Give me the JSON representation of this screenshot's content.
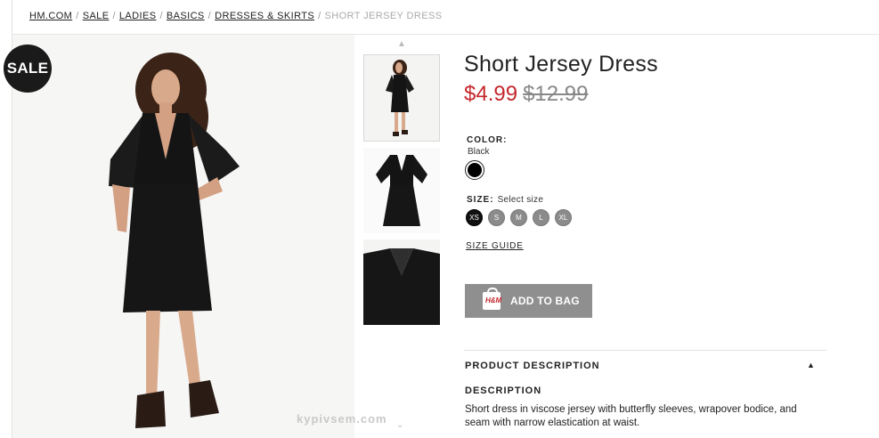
{
  "breadcrumb": {
    "items": [
      "HM.COM",
      "SALE",
      "LADIES",
      "BASICS",
      "DRESSES & SKIRTS"
    ],
    "separator": "/",
    "current": "SHORT JERSEY DRESS"
  },
  "gallery": {
    "sale_badge": "SALE",
    "watermark": "kypivsem.com",
    "up_arrow": "▲",
    "down_arrow": "⌄"
  },
  "product": {
    "title": "Short Jersey Dress",
    "price_sale": "$4.99",
    "price_original": "$12.99",
    "color_label": "COLOR:",
    "color_value": "Black",
    "size_label": "SIZE:",
    "size_placeholder": "Select size",
    "sizes": [
      "XS",
      "S",
      "M",
      "L",
      "XL"
    ],
    "size_guide": "SIZE GUIDE",
    "add_to_bag": "ADD TO BAG",
    "bag_logo": "H&M"
  },
  "description": {
    "header": "PRODUCT DESCRIPTION",
    "sub": "DESCRIPTION",
    "text": "Short dress in viscose jersey with butterfly sleeves, wrapover bodice, and seam with narrow elastication at waist."
  },
  "colors": {
    "sale_price": "#c4272d",
    "button_bg": "#8f8f8f",
    "swatch": "#000000"
  }
}
